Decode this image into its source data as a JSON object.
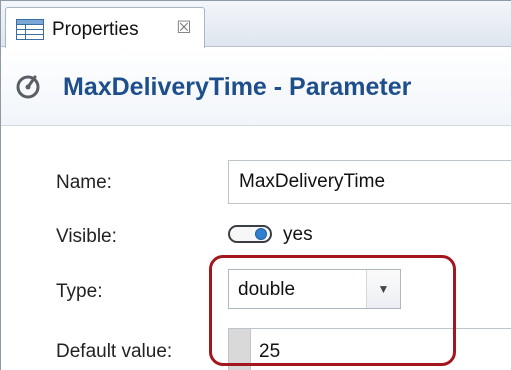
{
  "tab": {
    "label": "Properties",
    "icon": "properties-table-icon",
    "close_icon": "close-icon",
    "close_glyph": "☒"
  },
  "header": {
    "title": "MaxDeliveryTime - Parameter",
    "icon": "parameter-icon"
  },
  "form": {
    "name": {
      "label": "Name:",
      "value": "MaxDeliveryTime"
    },
    "visible": {
      "label": "Visible:",
      "state": "on",
      "text": "yes"
    },
    "type": {
      "label": "Type:",
      "value": "double",
      "arrow": "▼"
    },
    "default_value": {
      "label": "Default value:",
      "value": "25"
    }
  },
  "colors": {
    "header_title": "#1e4e8c",
    "highlight_border": "#a3161d",
    "toggle_knob": "#2f7fd0"
  }
}
